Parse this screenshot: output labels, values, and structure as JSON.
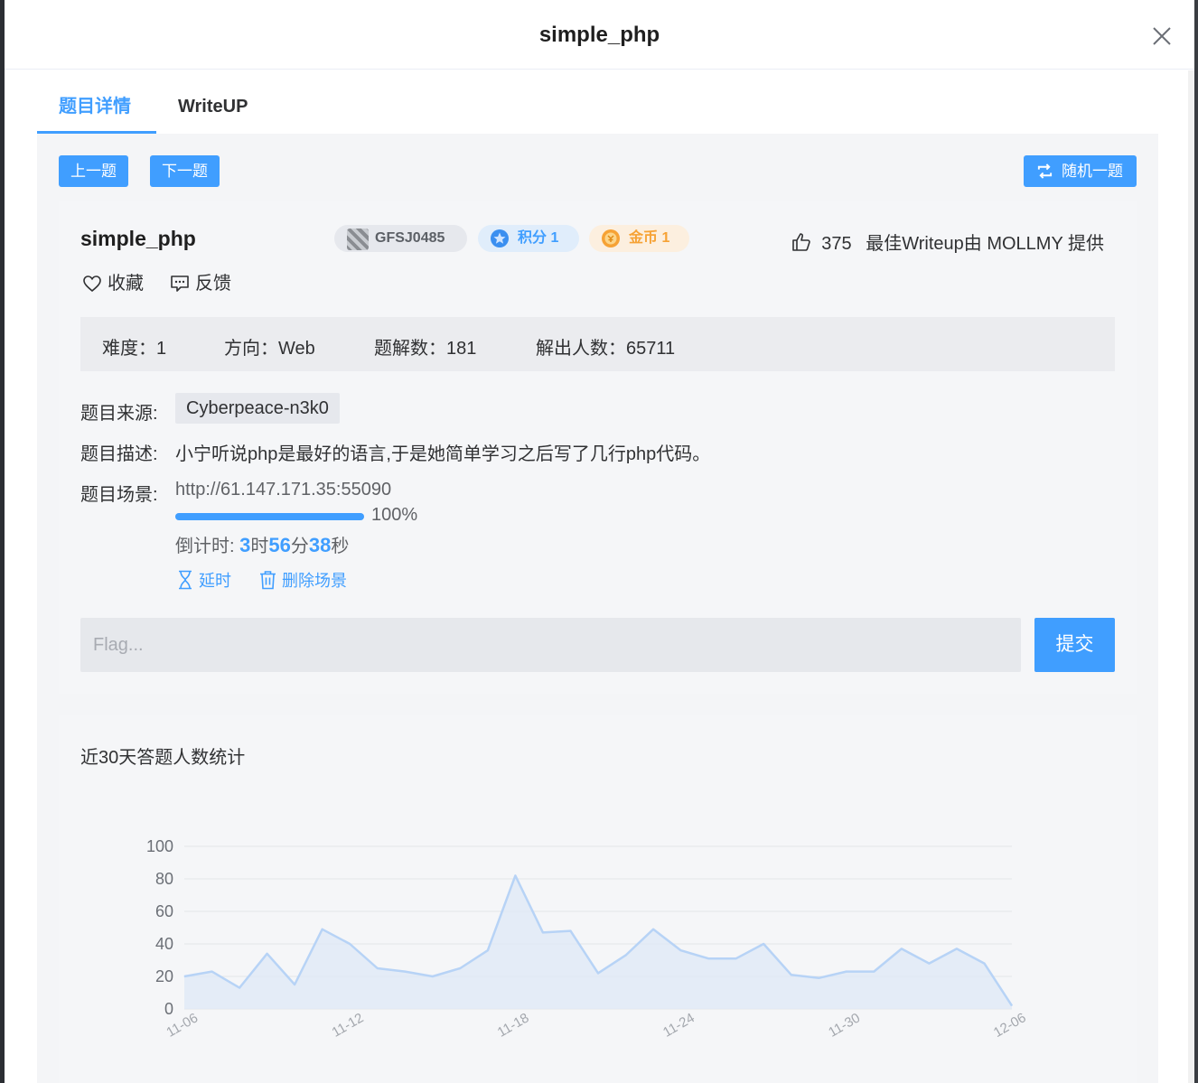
{
  "modal": {
    "title": "simple_php"
  },
  "tabs": [
    {
      "label": "题目详情",
      "active": true
    },
    {
      "label": "WriteUP",
      "active": false
    }
  ],
  "nav": {
    "prev": "上一题",
    "next": "下一题",
    "random": "随机一题"
  },
  "problem": {
    "title": "simple_php",
    "author": "GFSJ0485",
    "score": "积分 1",
    "gold": "金币 1",
    "likes": "375",
    "best_writeup": "最佳Writeup由 MOLLMY 提供",
    "favorite": "收藏",
    "feedback": "反馈"
  },
  "info": {
    "difficulty": "难度：1",
    "direction": "方向：Web",
    "solves": "题解数：181",
    "solvers": "解出人数：65711"
  },
  "details": {
    "source_label": "题目来源:",
    "source": "Cyberpeace-n3k0",
    "desc_label": "题目描述:",
    "desc": "小宁听说php是最好的语言,于是她简单学习之后写了几行php代码。",
    "scene_label": "题目场景:",
    "scene_url": "http://61.147.171.35:55090",
    "progress": 1.0,
    "progress_text": "100%",
    "countdown_prefix": "倒计时: ",
    "hours": "3",
    "hours_unit": "时",
    "minutes": "56",
    "minutes_unit": "分",
    "seconds": "38",
    "seconds_unit": "秒",
    "extend": "延时",
    "delete_scene": "删除场景"
  },
  "flag": {
    "placeholder": "Flag...",
    "submit": "提交"
  },
  "colors": {
    "accent": "#409eff",
    "gold": "#f6a235"
  },
  "chart_data": {
    "type": "area",
    "title": "近30天答题人数统计",
    "x": [
      "11-06",
      "11-07",
      "11-08",
      "11-09",
      "11-10",
      "11-11",
      "11-12",
      "11-13",
      "11-14",
      "11-15",
      "11-16",
      "11-17",
      "11-18",
      "11-19",
      "11-20",
      "11-21",
      "11-22",
      "11-23",
      "11-24",
      "11-25",
      "11-26",
      "11-27",
      "11-28",
      "11-29",
      "11-30",
      "12-01",
      "12-02",
      "12-03",
      "12-04",
      "12-05",
      "12-06"
    ],
    "values": [
      20,
      23,
      13,
      34,
      15,
      49,
      40,
      25,
      23,
      20,
      25,
      36,
      82,
      47,
      48,
      22,
      33,
      49,
      36,
      31,
      31,
      40,
      21,
      19,
      23,
      23,
      37,
      28,
      37,
      28,
      2
    ],
    "x_tick_labels": [
      "11-06",
      "11-12",
      "11-18",
      "11-24",
      "11-30",
      "12-06"
    ],
    "y_ticks": [
      0,
      20,
      40,
      60,
      80,
      100
    ],
    "ylim": [
      0,
      100
    ],
    "grid": true
  }
}
